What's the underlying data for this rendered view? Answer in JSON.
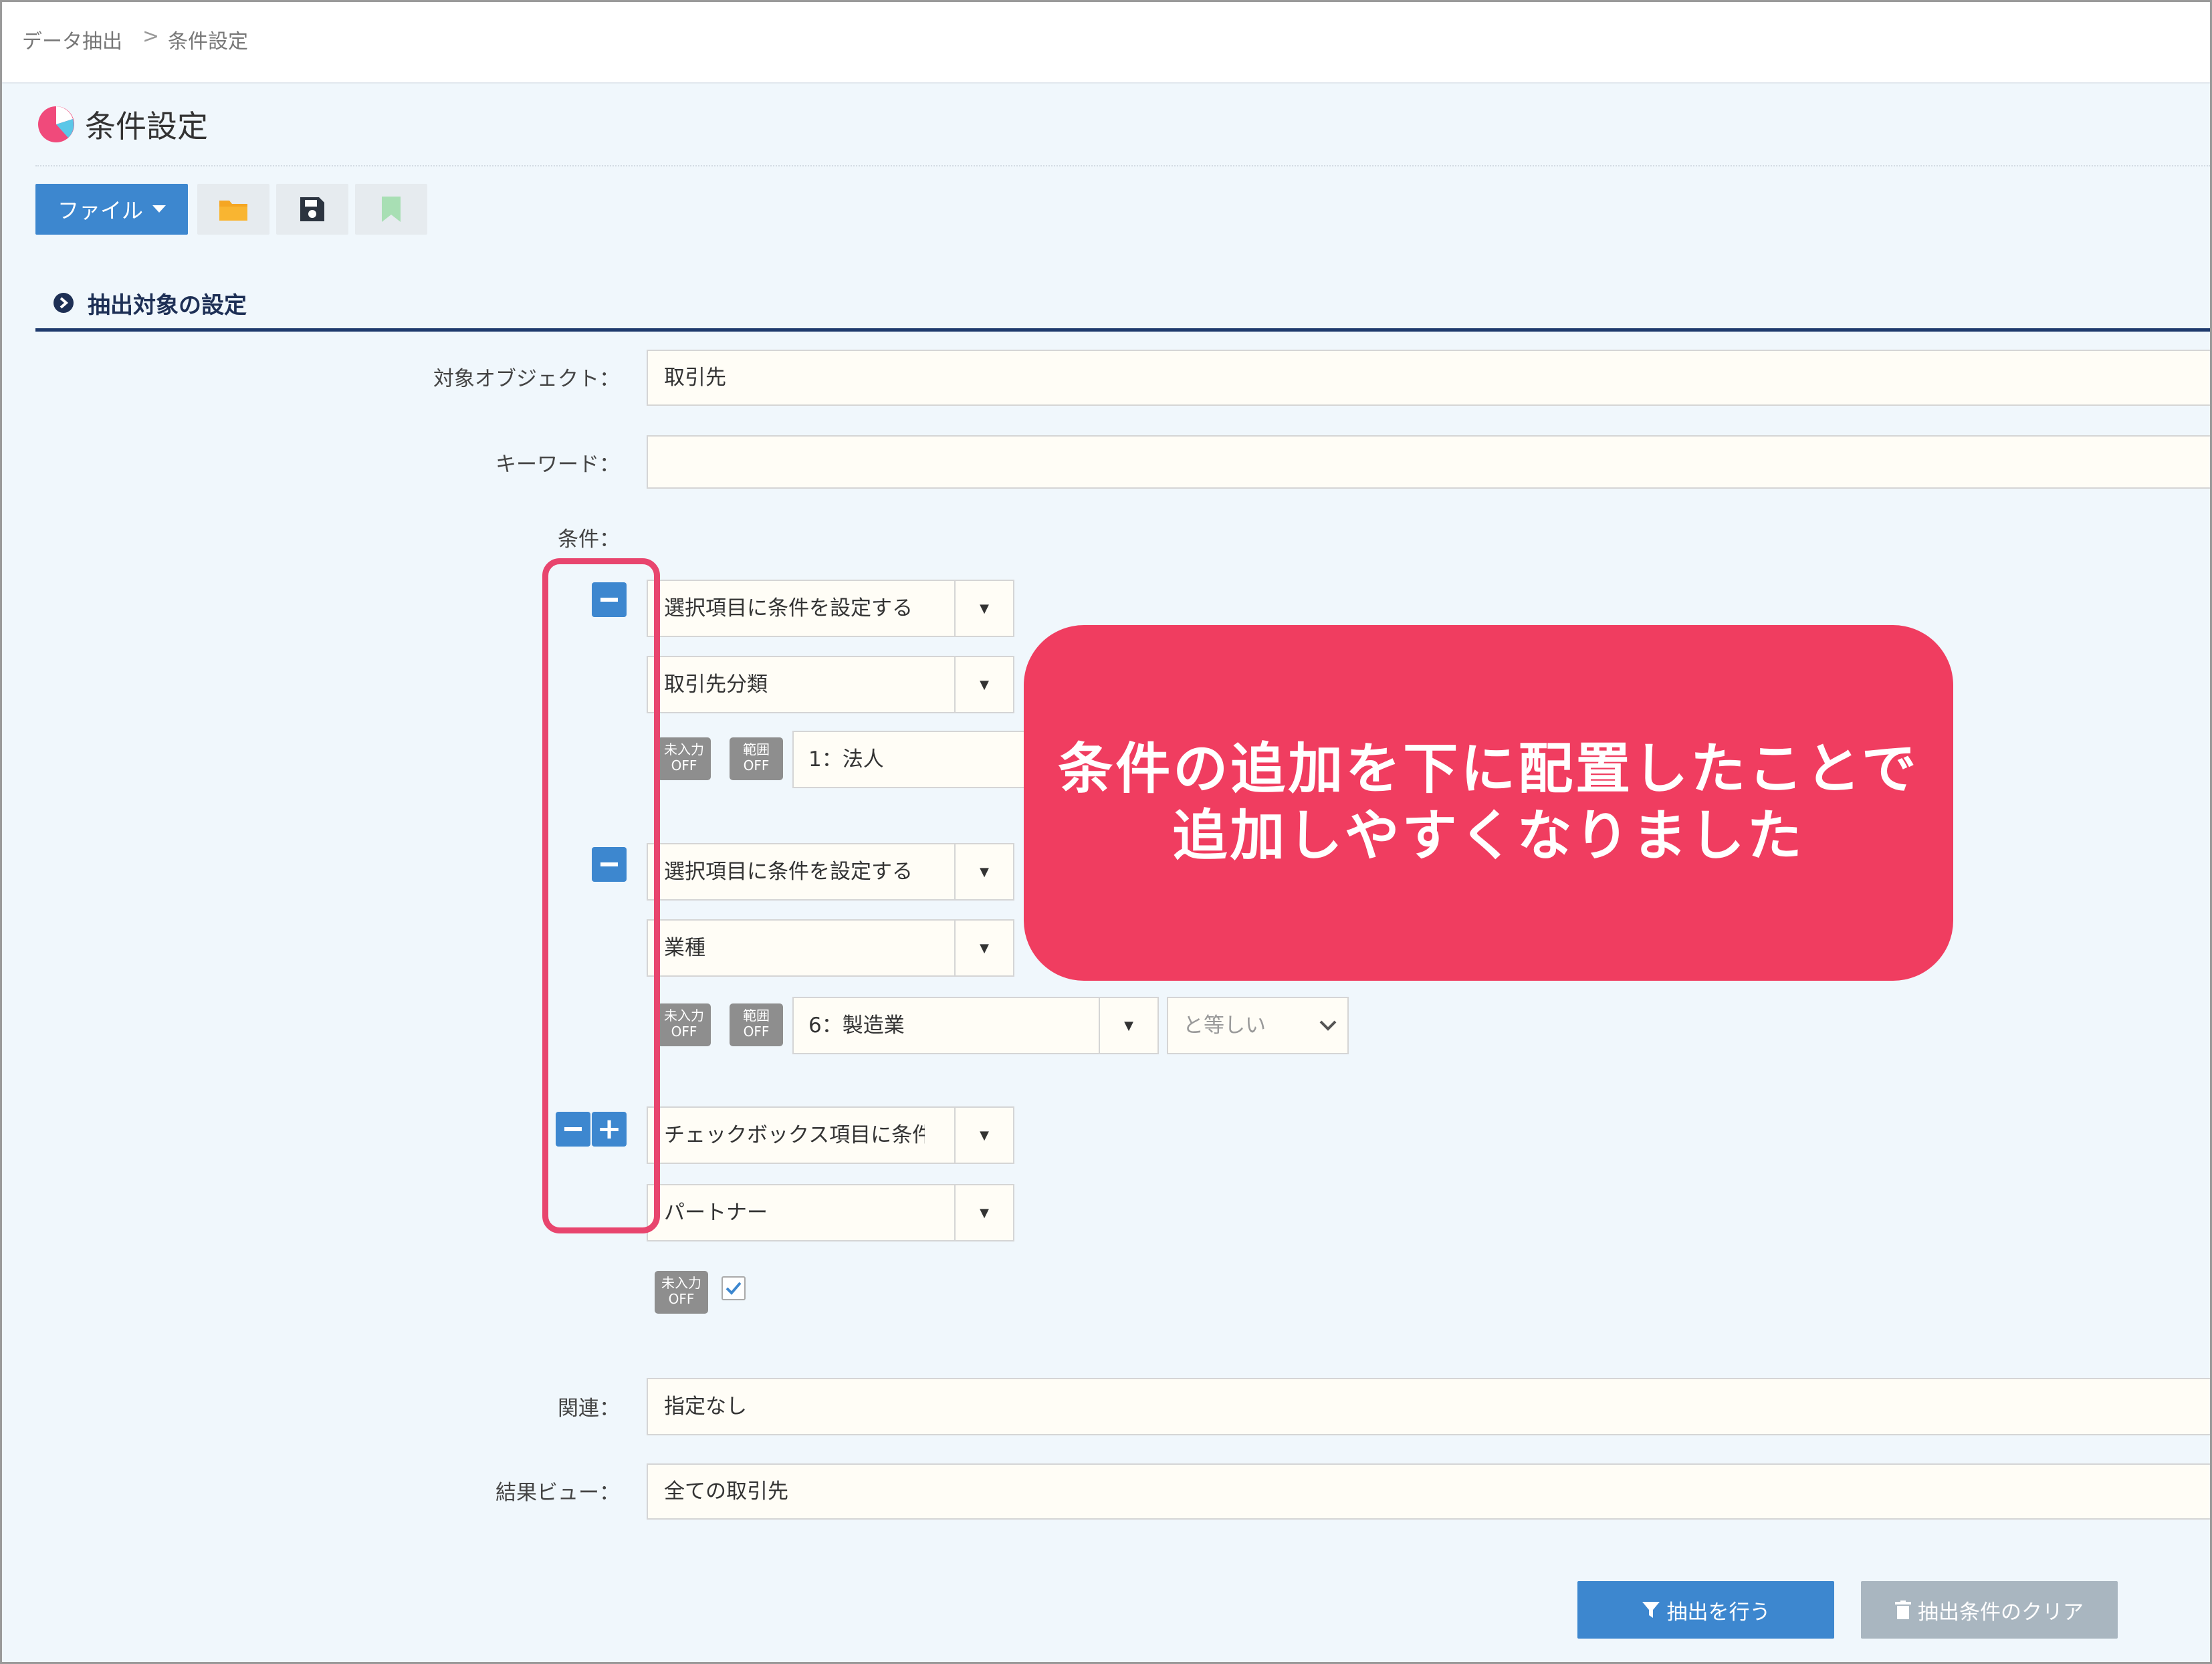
{
  "breadcrumb": {
    "items": [
      "データ抽出",
      "条件設定"
    ],
    "separator": ">"
  },
  "page": {
    "title": "条件設定"
  },
  "toolbar": {
    "file_label": "ファイル",
    "icons": [
      "caret-down-icon",
      "folder-icon",
      "save-icon",
      "bookmark-icon"
    ]
  },
  "section": {
    "title": "抽出対象の設定"
  },
  "form": {
    "object_label": "対象オブジェクト：",
    "object_value": "取引先",
    "keyword_label": "キーワード：",
    "keyword_value": "",
    "condition_label": "条件：",
    "related_label": "関連：",
    "related_value": "指定なし",
    "view_label": "結果ビュー：",
    "view_value": "全ての取引先"
  },
  "conditions": [
    {
      "type_select": "選択項目に条件を設定する",
      "field_select": "取引先分類",
      "badge_empty": [
        "未入力",
        "OFF"
      ],
      "badge_range": [
        "範囲",
        "OFF"
      ],
      "value": "1：法人"
    },
    {
      "type_select": "選択項目に条件を設定する",
      "field_select": "業種",
      "badge_empty": [
        "未入力",
        "OFF"
      ],
      "badge_range": [
        "範囲",
        "OFF"
      ],
      "value": "6：製造業",
      "operator": "と等しい"
    },
    {
      "type_select": "チェックボックス項目に条件を",
      "field_select": "パートナー",
      "badge_empty": [
        "未入力",
        "OFF"
      ],
      "checked": true
    }
  ],
  "callout": {
    "line1": "条件の追加を下に配置したことで",
    "line2": "追加しやすくなりました"
  },
  "actions": {
    "extract_label": "抽出を行う",
    "clear_label": "抽出条件のクリア"
  },
  "colors": {
    "primary": "#3d87cf",
    "callout": "#f03d60",
    "outline": "#e8456e",
    "section_line": "#1e3a6d",
    "background": "#f0f7fc",
    "disabled": "#a9b6c0"
  }
}
